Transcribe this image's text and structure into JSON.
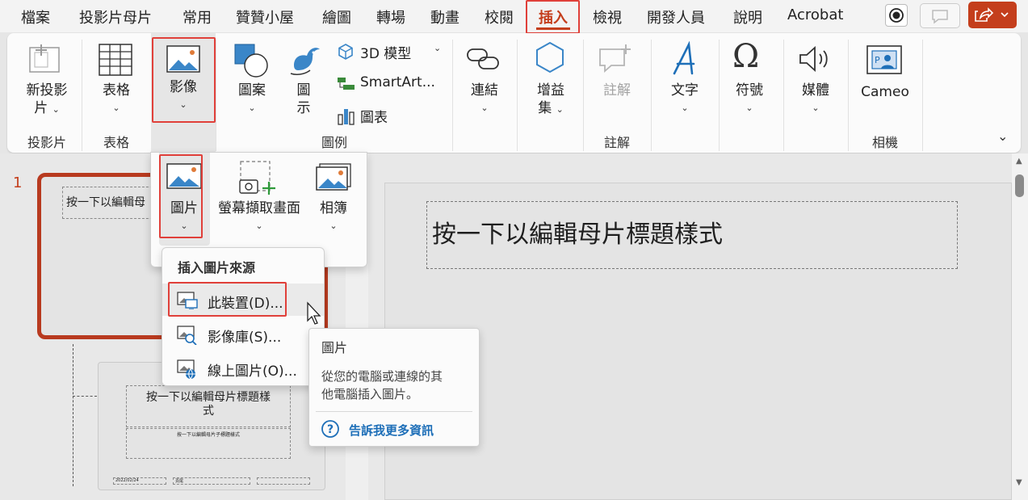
{
  "menu_tabs": [
    "檔案",
    "投影片母片",
    "常用",
    "贊贊小屋",
    "繪圖",
    "轉場",
    "動畫",
    "校閱",
    "插入",
    "檢視",
    "開發人員",
    "說明",
    "Acrobat"
  ],
  "ribbon": {
    "slides_group": {
      "button_line1": "新投影",
      "button_line2": "片",
      "label": "投影片"
    },
    "table_group": {
      "button": "表格",
      "label": "表格"
    },
    "images": {
      "button": "影像"
    },
    "illustrations": {
      "shapes_line1": "圖案",
      "icons_line1": "圖",
      "icons_line2": "示",
      "model_3d": "3D 模型",
      "smartart": "SmartArt...",
      "chart": "圖表",
      "label": "圖例"
    },
    "links": {
      "button": "連結"
    },
    "addins": {
      "button_line1": "增益",
      "button_line2": "集"
    },
    "comments": {
      "button": "註解",
      "label": "註解"
    },
    "text": {
      "button": "文字"
    },
    "symbols": {
      "button": "符號"
    },
    "media": {
      "button": "媒體"
    },
    "camera": {
      "button": "Cameo",
      "label": "相機"
    }
  },
  "image_dropdown": {
    "picture": "圖片",
    "screenshot": "螢幕擷取畫面",
    "album": "相簿"
  },
  "source_menu": {
    "header": "插入圖片來源",
    "items": [
      "此裝置(D)...",
      "影像庫(S)...",
      "線上圖片(O)..."
    ]
  },
  "tooltip": {
    "title": "圖片",
    "body_line1": "從您的電腦或連線的其",
    "body_line2": "他電腦插入圖片。",
    "link": "告訴我更多資訊"
  },
  "thumbs": {
    "slide_number": "1",
    "thumb1_title": "按一下以編輯母",
    "thumb2_title_line1": "按一下以編輯母片標題樣",
    "thumb2_title_line2": "式",
    "thumb2_sub": "按一下以編輯母片子標題樣式",
    "footer_date": "2022/02/24",
    "footer_mid": "頁尾"
  },
  "slide_title": "按一下以編輯母片標題樣式",
  "colors": {
    "accent": "#c43e1c",
    "highlight": "#e0403a",
    "blue": "#1e6fb8"
  }
}
